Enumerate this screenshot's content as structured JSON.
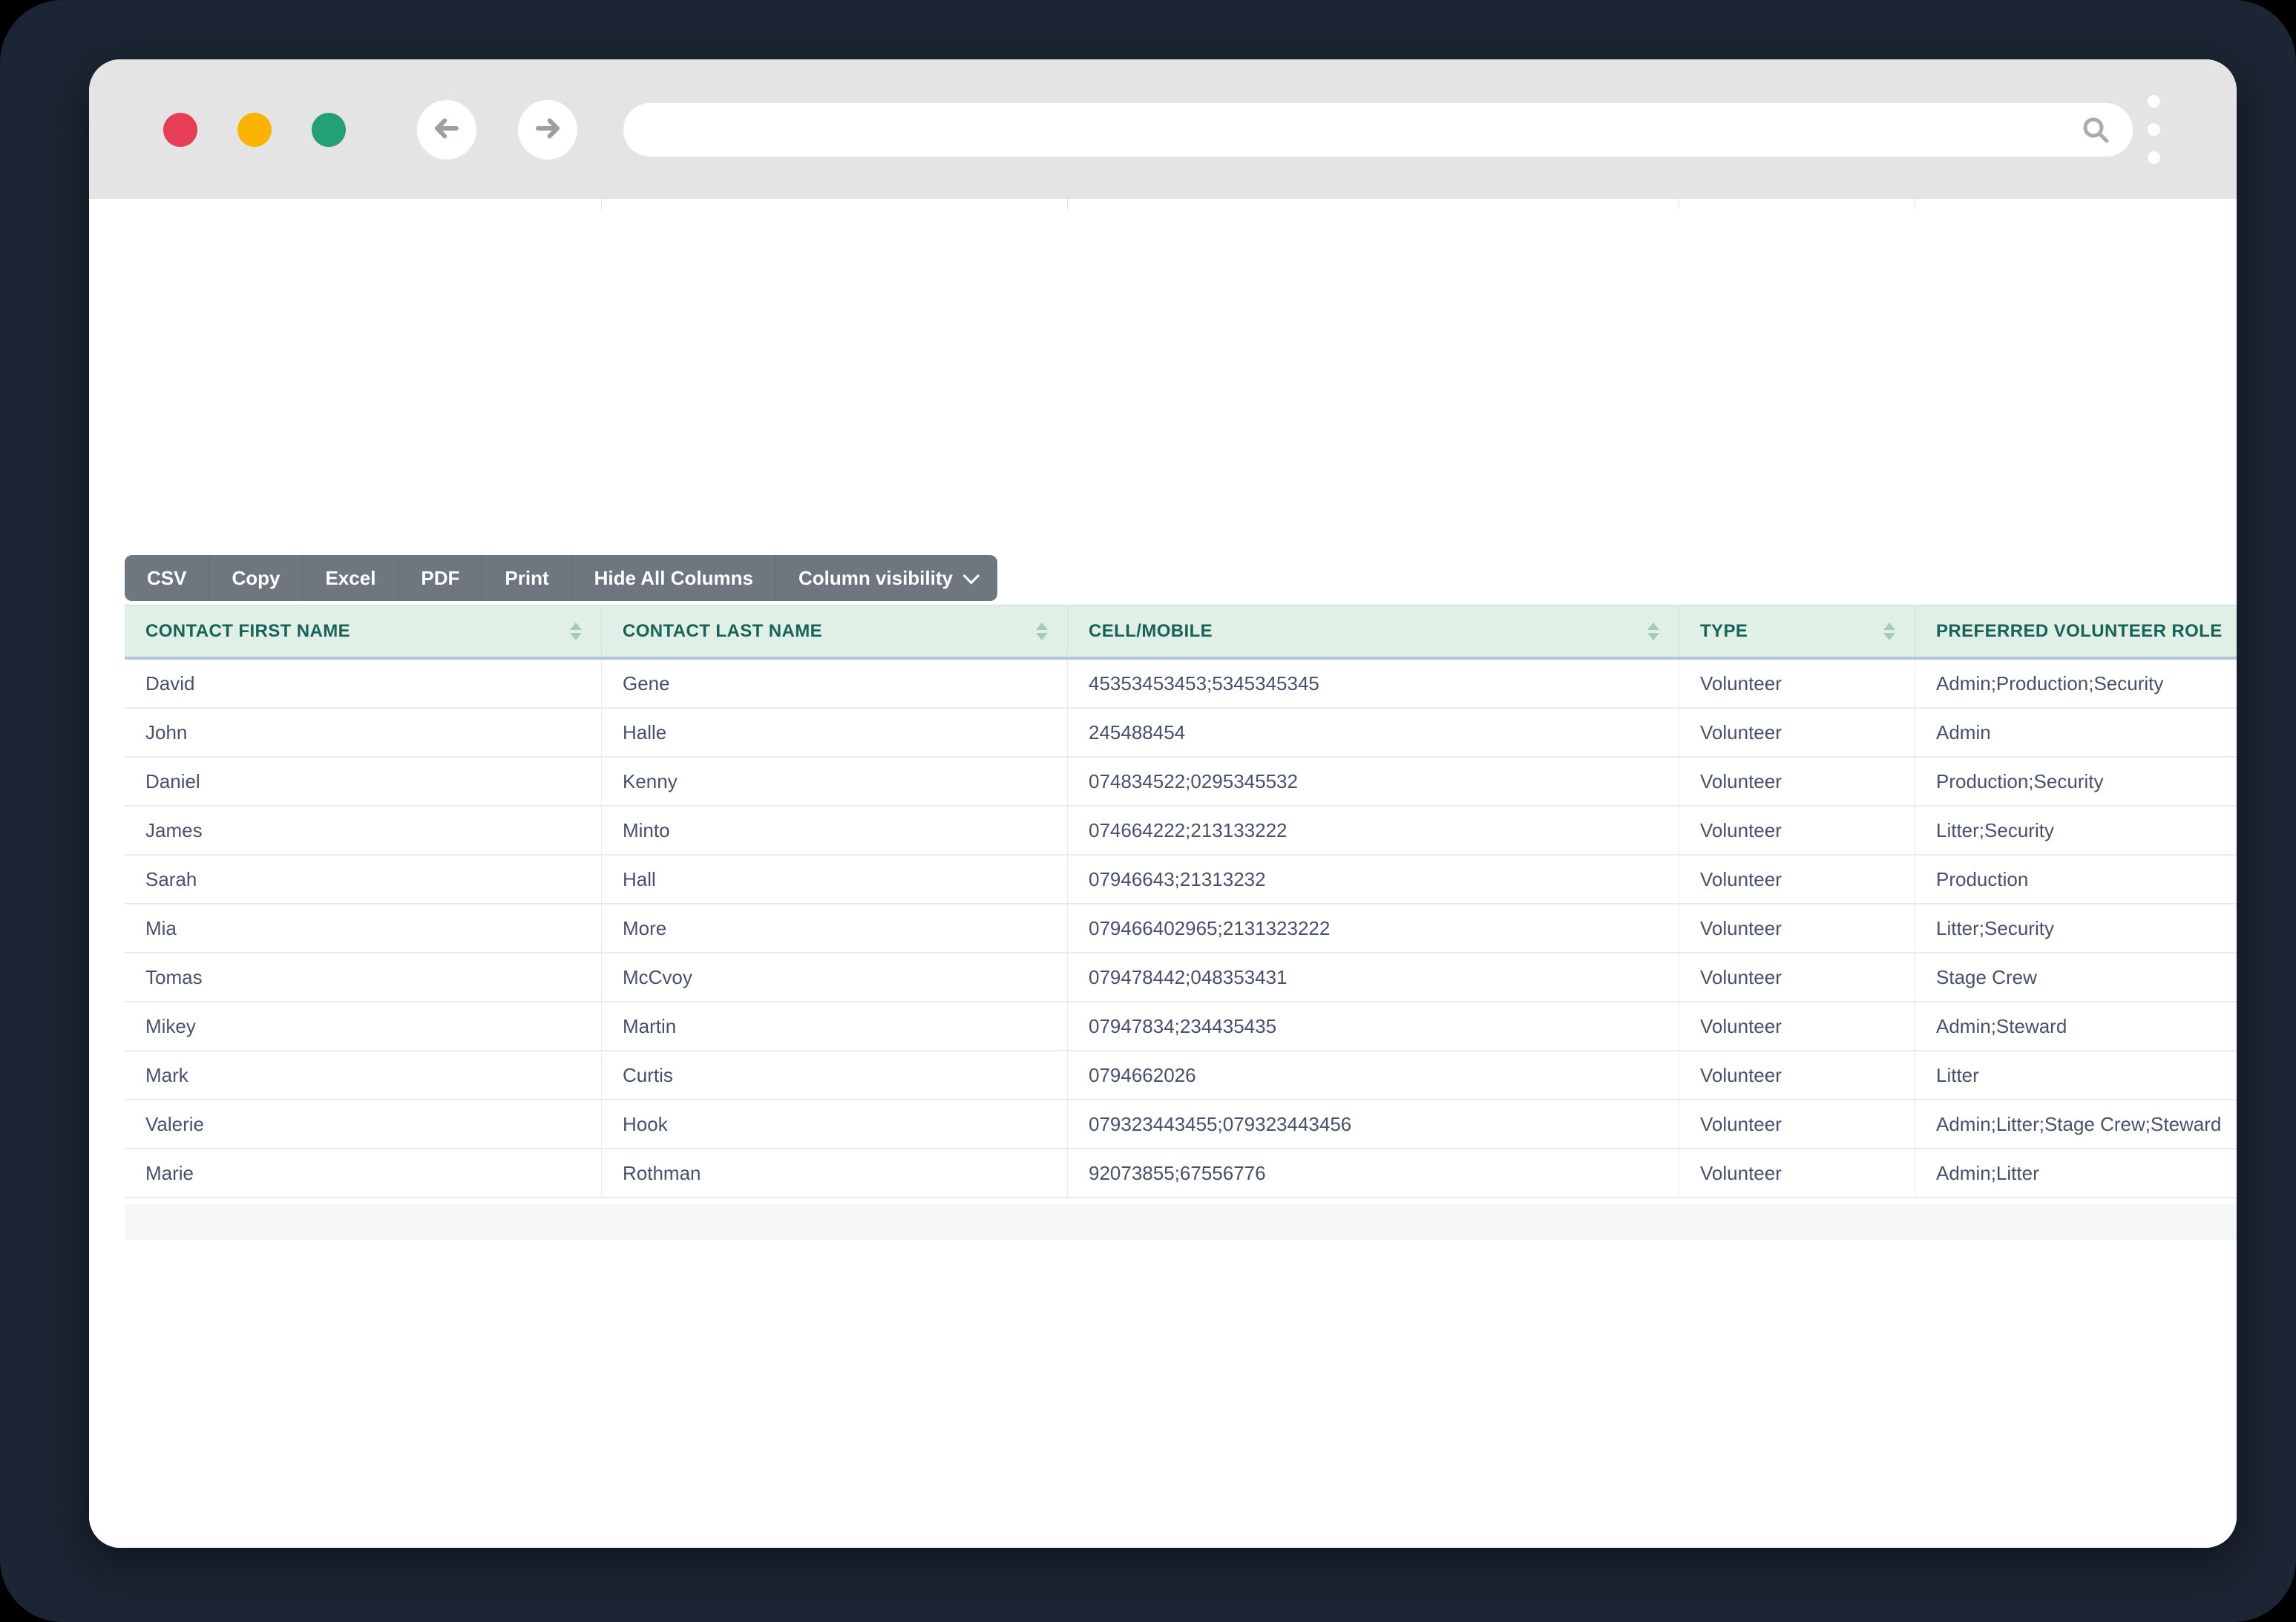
{
  "browser": {
    "traffic_lights": {
      "close": "#e63f55",
      "minimize": "#fcb400",
      "maximize": "#23a175"
    },
    "back_label": "back",
    "forward_label": "forward",
    "address_value": "",
    "icons": [
      "back-arrow-icon",
      "forward-arrow-icon",
      "search-icon",
      "kebab-menu-icon"
    ]
  },
  "toolbar": {
    "buttons": [
      "CSV",
      "Copy",
      "Excel",
      "PDF",
      "Print",
      "Hide All Columns"
    ],
    "column_visibility_label": "Column visibility"
  },
  "table": {
    "columns": [
      "CONTACT FIRST NAME",
      "CONTACT LAST NAME",
      "CELL/MOBILE",
      "TYPE",
      "PREFERRED VOLUNTEER ROLE"
    ],
    "rows": [
      {
        "first_name": "David",
        "last_name": "Gene",
        "cell_mobile": "45353453453;5345345345",
        "type": "Volunteer",
        "role": "Admin;Production;Security"
      },
      {
        "first_name": "John",
        "last_name": "Halle",
        "cell_mobile": "245488454",
        "type": "Volunteer",
        "role": "Admin"
      },
      {
        "first_name": "Daniel",
        "last_name": "Kenny",
        "cell_mobile": "074834522;0295345532",
        "type": "Volunteer",
        "role": "Production;Security"
      },
      {
        "first_name": "James",
        "last_name": "Minto",
        "cell_mobile": "074664222;213133222",
        "type": "Volunteer",
        "role": "Litter;Security"
      },
      {
        "first_name": "Sarah",
        "last_name": "Hall",
        "cell_mobile": "07946643;21313232",
        "type": "Volunteer",
        "role": "Production"
      },
      {
        "first_name": "Mia",
        "last_name": "More",
        "cell_mobile": "079466402965;2131323222",
        "type": "Volunteer",
        "role": "Litter;Security"
      },
      {
        "first_name": "Tomas",
        "last_name": "McCvoy",
        "cell_mobile": "079478442;048353431",
        "type": "Volunteer",
        "role": "Stage Crew"
      },
      {
        "first_name": "Mikey",
        "last_name": "Martin",
        "cell_mobile": "07947834;234435435",
        "type": "Volunteer",
        "role": "Admin;Steward"
      },
      {
        "first_name": "Mark",
        "last_name": "Curtis",
        "cell_mobile": "0794662026",
        "type": "Volunteer",
        "role": "Litter"
      },
      {
        "first_name": "Valerie",
        "last_name": "Hook",
        "cell_mobile": "079323443455;079323443456",
        "type": "Volunteer",
        "role": "Admin;Litter;Stage Crew;Steward"
      },
      {
        "first_name": "Marie",
        "last_name": "Rothman",
        "cell_mobile": "92073855;67556776",
        "type": "Volunteer",
        "role": "Admin;Litter"
      }
    ]
  },
  "colors": {
    "surround": "#1c2533",
    "chrome": "#e4e4e4",
    "toolbar_bg": "#6e7680",
    "header_bg": "#e0f0e6",
    "header_text": "#176358",
    "header_border": "#b7c4d8",
    "row_text": "#47516a",
    "footer_strip": "#f5f6f8"
  }
}
